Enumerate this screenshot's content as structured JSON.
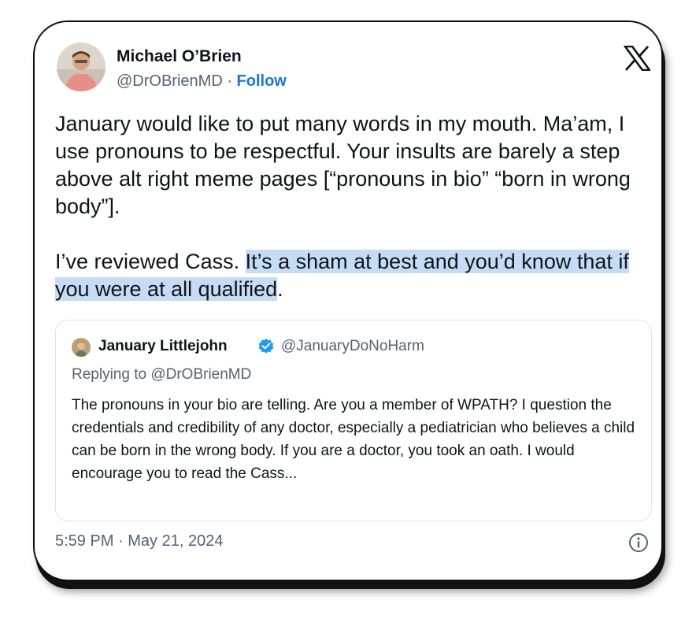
{
  "author": {
    "name": "Michael O’Brien",
    "handle": "@DrOBrienMD",
    "separator": " · ",
    "follow_label": "Follow"
  },
  "tweet": {
    "para1": "January would like to put many words in my mouth. Ma’am, I use pronouns to be respectful. Your insults are barely a step above alt right meme pages [“pronouns in bio” “born in wrong body”].",
    "para2_plain_start": "I’ve reviewed Cass. ",
    "para2_highlighted": "It’s a sham at best and you’d know that if you were at all qualified",
    "para2_plain_end": "."
  },
  "quoted_tweet": {
    "name": "January Littlejohn",
    "handle": "@JanuaryDoNoHarm",
    "replying_to": "Replying to @DrOBrienMD",
    "text": "The pronouns in your bio are telling. Are you a member of WPATH? I question the credentials and credibility of any doctor, especially a pediatrician who believes a child can be born in the wrong body. If you are a doctor, you took an oath. I would encourage you to read the Cass..."
  },
  "footer": {
    "timestamp": "5:59 PM · May 21, 2024"
  },
  "icons": {
    "brand": "x-logo-icon",
    "verified": "verified-badge-icon",
    "info": "info-icon"
  },
  "colors": {
    "follow": "#1d74d9",
    "highlight": "#c6dcf5",
    "verified": "#1d9bf0",
    "secondary_text": "#536471"
  }
}
